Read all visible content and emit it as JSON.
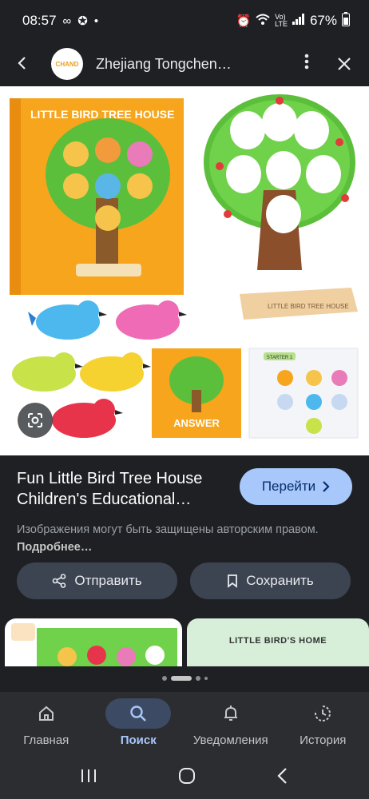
{
  "status": {
    "time": "08:57",
    "battery": "67%",
    "dot": "•"
  },
  "top_bar": {
    "title": "Zhejiang Tongchen…",
    "logo_text": "CHAND"
  },
  "image": {
    "box_title": "LITTLE BIRD TREE HOUSE",
    "stand_text": "LITTLE BIRD TREE HOUSE",
    "answer_card": "ANSWER",
    "starter_card": "STARTER 1"
  },
  "result": {
    "title": "Fun Little Bird Tree House Children's Educational…",
    "open_label": "Перейти",
    "copyright_text": "Изображения могут быть защищены авторским правом.",
    "copyright_more": "Подробнее…"
  },
  "actions": {
    "share_label": "Отправить",
    "save_label": "Сохранить"
  },
  "related": {
    "card2_text": "LITTLE BIRD'S HOME"
  },
  "bottom_nav": [
    {
      "label": "Главная",
      "icon": "home-icon"
    },
    {
      "label": "Поиск",
      "icon": "search-icon",
      "active": true
    },
    {
      "label": "Уведомления",
      "icon": "bell-icon"
    },
    {
      "label": "История",
      "icon": "history-icon"
    }
  ],
  "colors": {
    "background": "#1f2024",
    "accent": "#a8c7fa",
    "button": "#3c4452"
  }
}
